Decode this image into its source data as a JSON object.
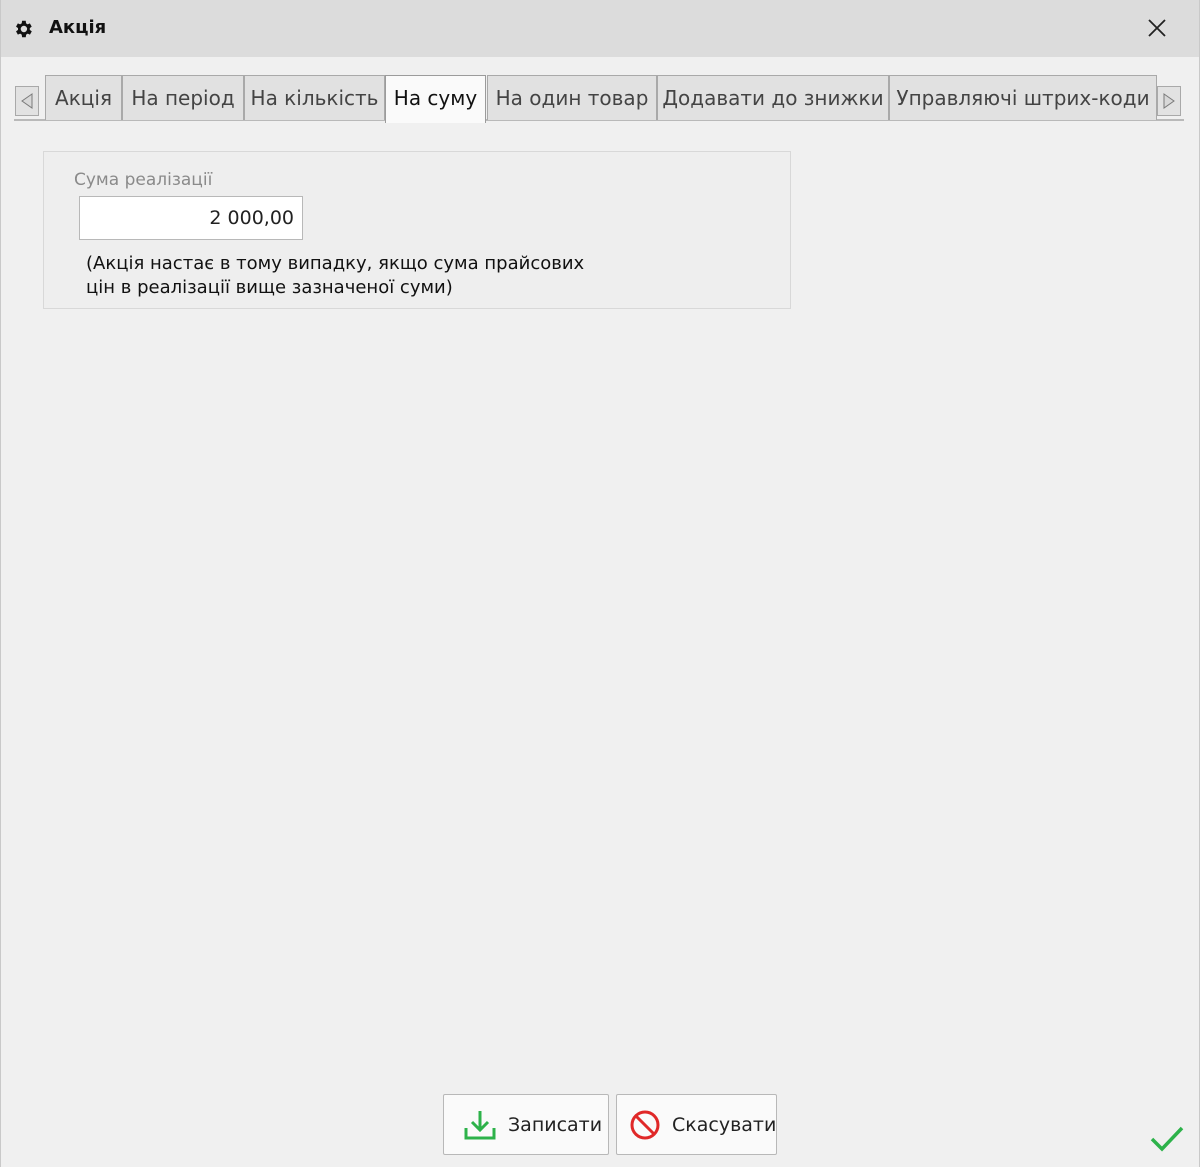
{
  "window": {
    "title": "Акція"
  },
  "tabs": [
    {
      "label": "Акція",
      "active": false
    },
    {
      "label": "На період",
      "active": false
    },
    {
      "label": "На кількість",
      "active": false
    },
    {
      "label": "На суму",
      "active": true
    },
    {
      "label": "На один товар",
      "active": false
    },
    {
      "label": "Додавати до знижки",
      "active": false
    },
    {
      "label": "Управляючі штрих-коди",
      "active": false
    }
  ],
  "form": {
    "sum_label": "Сума реалізації",
    "sum_value": "2 000,00",
    "note_line1": "(Акція настає в тому випадку, якщо сума прайсових",
    "note_line2": "цін в реалізації вище зазначеної суми)"
  },
  "buttons": {
    "save_label": "Записати",
    "cancel_label": "Скасувати"
  },
  "icons": {
    "title": "gear-icon",
    "close": "close-icon",
    "scroll_left": "triangle-left-icon",
    "scroll_right": "triangle-right-icon",
    "save": "download-icon",
    "cancel": "prohibited-icon",
    "status": "check-icon"
  },
  "colors": {
    "accent_green": "#2db24a",
    "cancel_red": "#e02828"
  }
}
